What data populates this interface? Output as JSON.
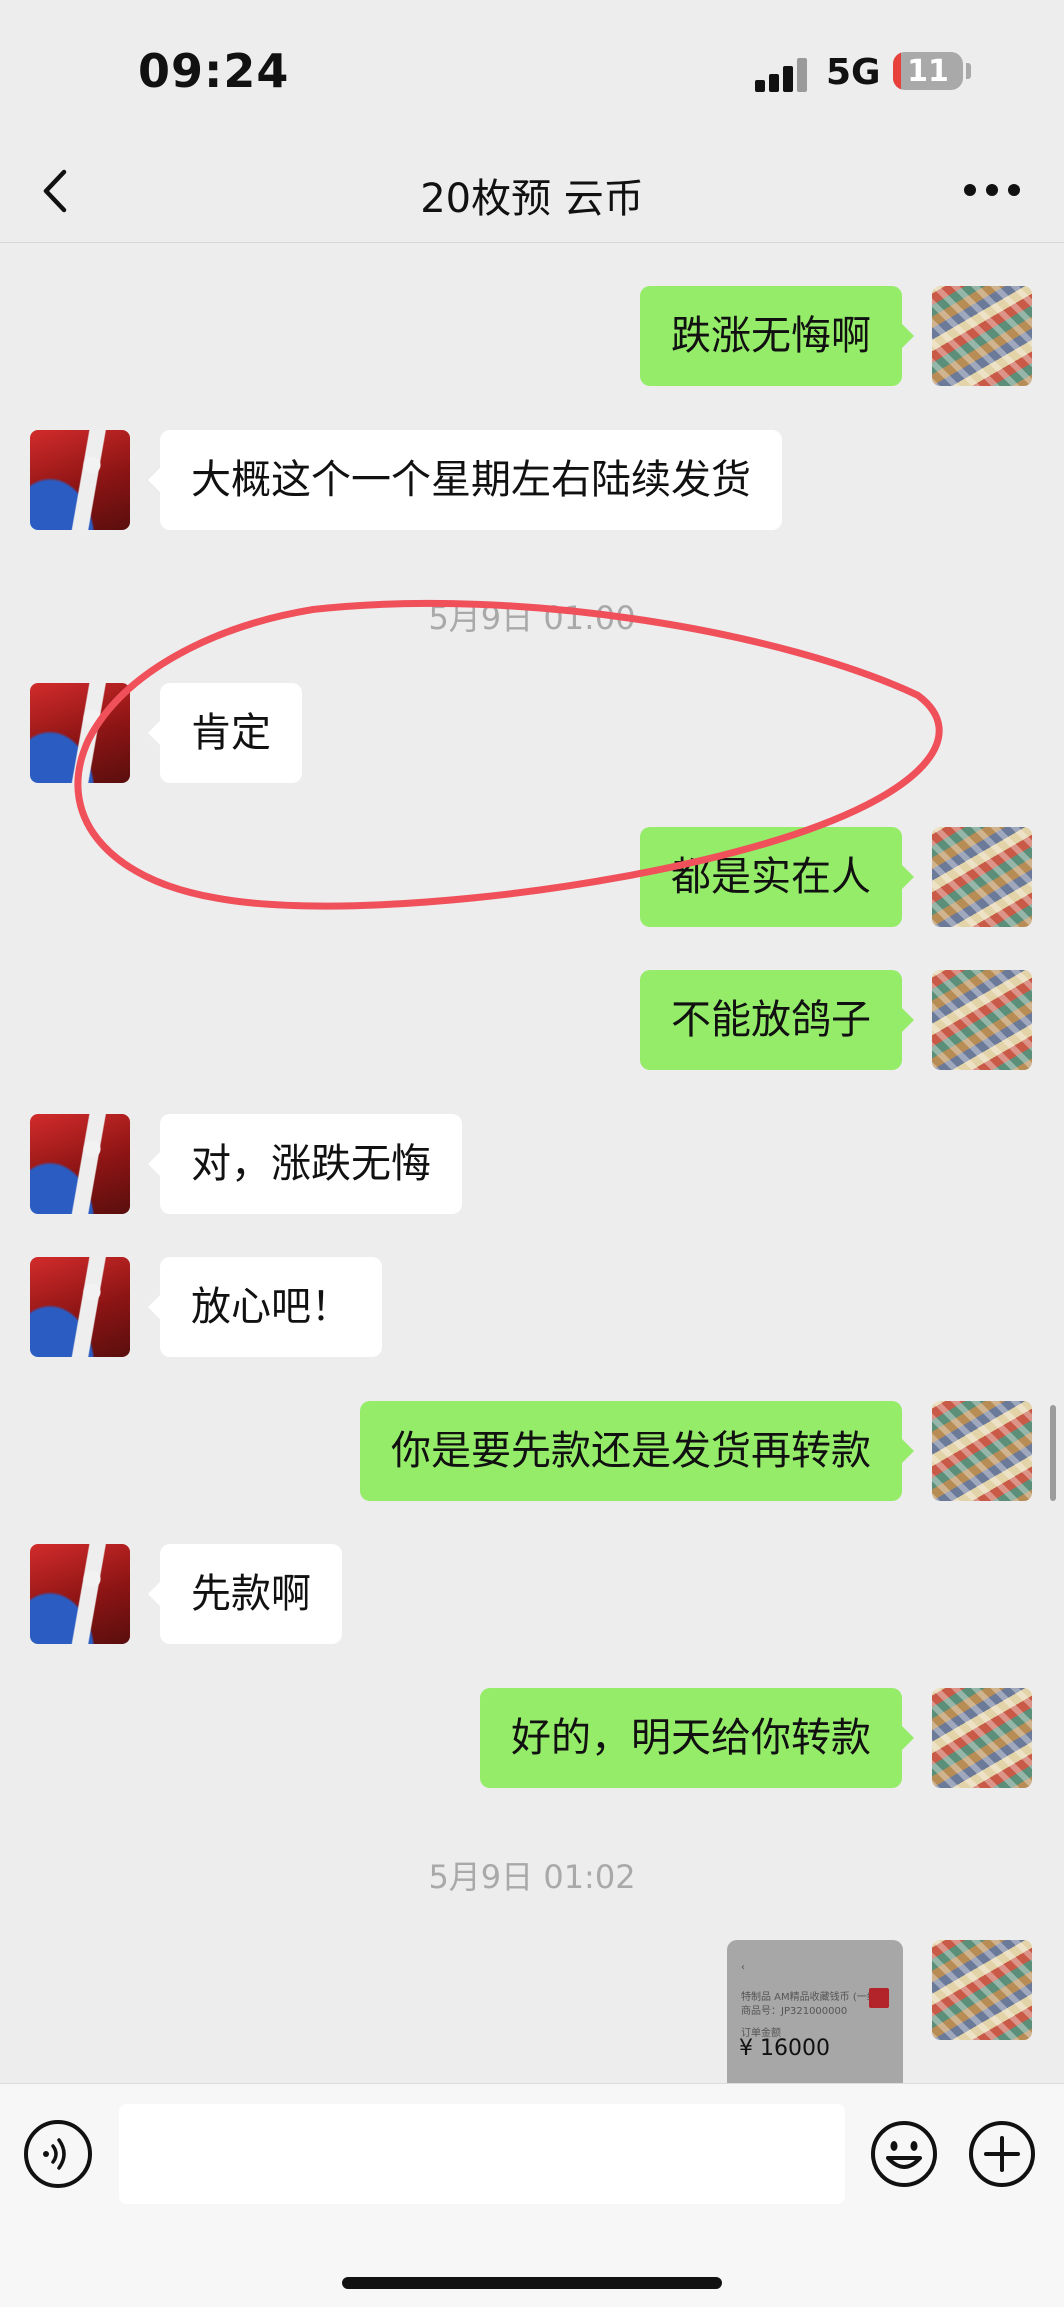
{
  "status_bar": {
    "time": "09:24",
    "network": "5G",
    "battery_level": "11",
    "battery_fraction": 0.11
  },
  "header": {
    "title": "20枚预 云币"
  },
  "messages": [
    {
      "side": "out",
      "text": "跌涨无悔啊"
    },
    {
      "side": "in",
      "text": "大概这个一个星期左右陆续发货"
    },
    {
      "side": "time",
      "text": "5月9日 01:00"
    },
    {
      "side": "in",
      "text": "肯定"
    },
    {
      "side": "out",
      "text": "都是实在人"
    },
    {
      "side": "out",
      "text": "不能放鸽子"
    },
    {
      "side": "in",
      "text": "对，涨跌无悔"
    },
    {
      "side": "in",
      "text": "放心吧！"
    },
    {
      "side": "out",
      "text": "你是要先款还是发货再转款"
    },
    {
      "side": "in",
      "text": "先款啊"
    },
    {
      "side": "out",
      "text": "好的，明天给你转款"
    },
    {
      "side": "time",
      "text": "5月9日 01:02"
    }
  ],
  "shared_card": {
    "lines": [
      "特制品 AM精品收藏钱币 (一组)",
      "商品号：JP321000000",
      "订单金额"
    ],
    "amount": "¥ 16000"
  },
  "input": {
    "placeholder": ""
  },
  "colors": {
    "outgoing_bubble": "#95ec69",
    "incoming_bubble": "#ffffff",
    "background": "#ededed",
    "circle_annotation": "#f0505a"
  }
}
